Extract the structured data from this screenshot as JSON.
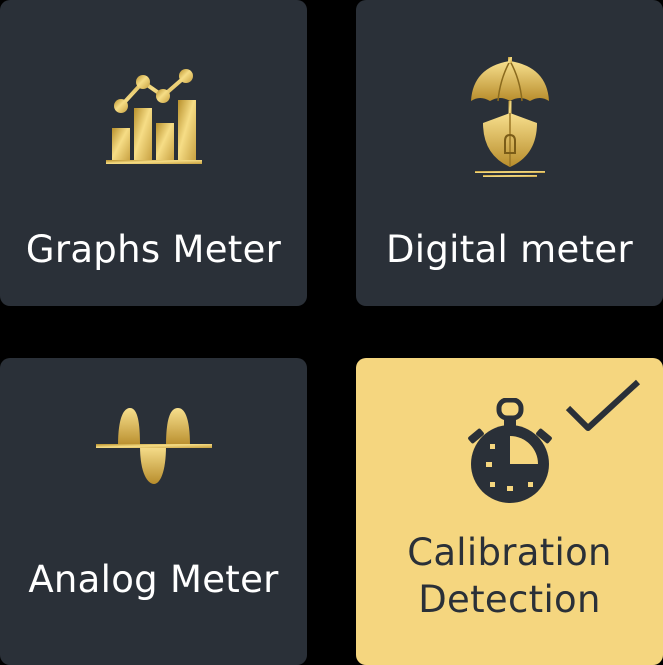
{
  "tiles": [
    {
      "id": "graphs",
      "label": "Graphs Meter",
      "icon": "bar-line-chart-icon",
      "selected": false
    },
    {
      "id": "digital",
      "label": "Digital meter",
      "icon": "umbrella-shield-icon",
      "selected": false
    },
    {
      "id": "analog",
      "label": "Analog Meter",
      "icon": "sine-wave-icon",
      "selected": false
    },
    {
      "id": "calibration",
      "label_line1": "Calibration",
      "label_line2": "Detection",
      "icon": "stopwatch-icon",
      "selected": true,
      "badge_icon": "checkmark-icon"
    }
  ],
  "colors": {
    "tile_background": "#2a3038",
    "tile_selected_background": "#f5d67f",
    "label_text": "#ffffff",
    "selected_text": "#2a3038",
    "icon_gold": "#d6b04a"
  }
}
